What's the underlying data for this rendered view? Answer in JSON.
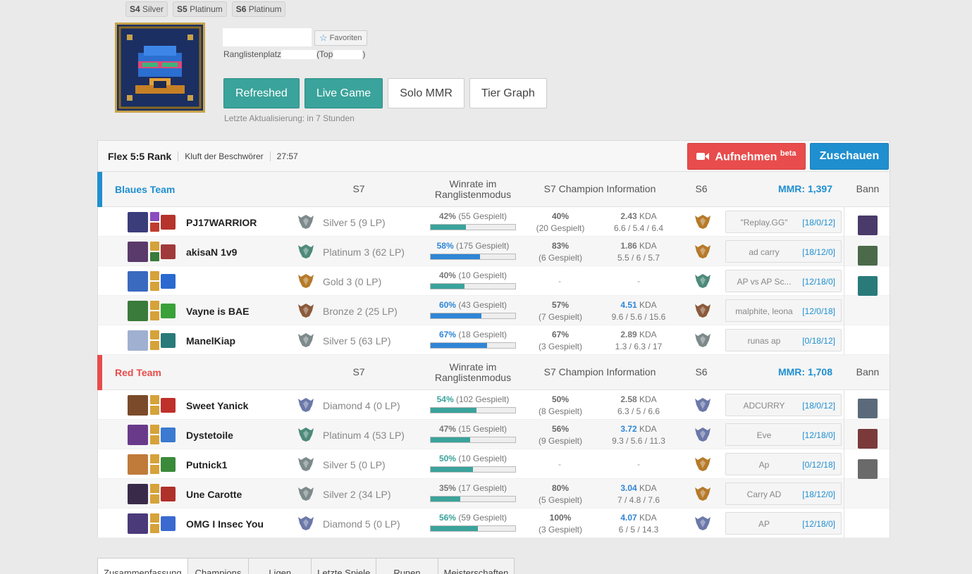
{
  "seasons": [
    {
      "season": "S4",
      "tier": "Silver"
    },
    {
      "season": "S5",
      "tier": "Platinum"
    },
    {
      "season": "S6",
      "tier": "Platinum"
    }
  ],
  "profile": {
    "favorite_label": "Favoriten",
    "ladder_label": "Ranglistenplatz",
    "top_label": "(Top",
    "top_close": ")"
  },
  "buttons": {
    "refreshed": "Refreshed",
    "live_game": "Live Game",
    "solo_mmr": "Solo MMR",
    "tier_graph": "Tier Graph"
  },
  "last_update": "Letzte Aktualisierung: in 7 Stunden",
  "game": {
    "mode": "Flex 5:5 Rank",
    "map": "Kluft der Beschwörer",
    "time": "27:57",
    "record_label": "Aufnehmen",
    "record_sup": "beta",
    "watch_label": "Zuschauen"
  },
  "headers": {
    "s7": "S7",
    "winrate_line1": "Winrate im",
    "winrate_line2": "Ranglistenmodus",
    "champ_info": "S7 Champion Information",
    "s6": "S6",
    "bann": "Bann"
  },
  "colors": {
    "blue_team": "#1f8fd0",
    "red_team": "#e84c4c",
    "teal": "#3aa39b",
    "bar_blue": "#2f86d6",
    "bar_teal": "#3aa39b"
  },
  "teams": [
    {
      "name": "Blaues Team",
      "mmr": "MMR: 1,397",
      "players": [
        {
          "name": "PJ17WARRIOR",
          "tier_icon": "silver-emblem-icon",
          "tier": "Silver 5 (9 LP)",
          "wr": "42%",
          "games": "(55 Gespielt)",
          "wr_value": 42,
          "c_wr": "40%",
          "c_games": "(20 Gespielt)",
          "kda": "2.43",
          "kda_detail": "6.6 / 5.4 / 6.4",
          "s6_icon": "gold-emblem-icon",
          "note": "\"Replay.GG\"",
          "score": "[18/0/12]"
        },
        {
          "name": "akisaN 1v9",
          "tier_icon": "platinum-emblem-icon",
          "tier": "Platinum 3 (62 LP)",
          "wr": "58%",
          "games": "(175 Gespielt)",
          "wr_value": 58,
          "c_wr": "83%",
          "c_games": "(6 Gespielt)",
          "kda": "1.86",
          "kda_detail": "5.5 / 6 / 5.7",
          "s6_icon": "gold-emblem-icon",
          "note": "ad carry",
          "score": "[18/12/0]"
        },
        {
          "name": "",
          "tier_icon": "gold-emblem-icon",
          "tier": "Gold 3 (0 LP)",
          "wr": "40%",
          "games": "(10 Gespielt)",
          "wr_value": 40,
          "c_wr": "-",
          "c_games": "",
          "kda": "-",
          "kda_detail": "",
          "s6_icon": "platinum-emblem-icon",
          "note": "AP vs AP Sc...",
          "score": "[12/18/0]"
        },
        {
          "name": "Vayne is BAE",
          "tier_icon": "bronze-emblem-icon",
          "tier": "Bronze 2 (25 LP)",
          "wr": "60%",
          "games": "(43 Gespielt)",
          "wr_value": 60,
          "c_wr": "57%",
          "c_games": "(7 Gespielt)",
          "kda": "4.51",
          "kda_detail": "9.6 / 5.6 / 15.6",
          "s6_icon": "bronze-emblem-icon",
          "note": "malphite, leona",
          "score": "[12/0/18]"
        },
        {
          "name": "ManelKiap",
          "tier_icon": "silver-emblem-icon",
          "tier": "Silver 5 (63 LP)",
          "wr": "67%",
          "games": "(18 Gespielt)",
          "wr_value": 67,
          "c_wr": "67%",
          "c_games": "(3 Gespielt)",
          "kda": "2.89",
          "kda_detail": "1.3 / 6.3 / 17",
          "s6_icon": "silver-emblem-icon",
          "note": "runas ap",
          "score": "[0/18/12]"
        }
      ]
    },
    {
      "name": "Red Team",
      "mmr": "MMR: 1,708",
      "players": [
        {
          "name": "Sweet Yanick",
          "tier_icon": "diamond-emblem-icon",
          "tier": "Diamond 4 (0 LP)",
          "wr": "54%",
          "games": "(102 Gespielt)",
          "wr_value": 54,
          "c_wr": "50%",
          "c_games": "(8 Gespielt)",
          "kda": "2.58",
          "kda_detail": "6.3 / 5 / 6.6",
          "s6_icon": "diamond-emblem-icon",
          "note": "ADCURRY",
          "score": "[18/0/12]"
        },
        {
          "name": "Dystetoile",
          "tier_icon": "platinum-emblem-icon",
          "tier": "Platinum 4 (53 LP)",
          "wr": "47%",
          "games": "(15 Gespielt)",
          "wr_value": 47,
          "c_wr": "56%",
          "c_games": "(9 Gespielt)",
          "kda": "3.72",
          "kda_detail": "9.3 / 5.6 / 11.3",
          "s6_icon": "diamond-emblem-icon",
          "note": "Eve",
          "score": "[12/18/0]"
        },
        {
          "name": "Putnick1",
          "tier_icon": "silver-emblem-icon",
          "tier": "Silver 5 (0 LP)",
          "wr": "50%",
          "games": "(10 Gespielt)",
          "wr_value": 50,
          "c_wr": "-",
          "c_games": "",
          "kda": "-",
          "kda_detail": "",
          "s6_icon": "gold-emblem-icon",
          "note": "Ap",
          "score": "[0/12/18]"
        },
        {
          "name": "Une Carotte",
          "tier_icon": "silver-emblem-icon",
          "tier": "Silver 2 (34 LP)",
          "wr": "35%",
          "games": "(17 Gespielt)",
          "wr_value": 35,
          "c_wr": "80%",
          "c_games": "(5 Gespielt)",
          "kda": "3.04",
          "kda_detail": "7 / 4.8 / 7.6",
          "s6_icon": "gold-emblem-icon",
          "note": "Carry AD",
          "score": "[18/12/0]"
        },
        {
          "name": "OMG I Insec You",
          "tier_icon": "diamond-emblem-icon",
          "tier": "Diamond 5 (0 LP)",
          "wr": "56%",
          "games": "(59 Gespielt)",
          "wr_value": 56,
          "c_wr": "100%",
          "c_games": "(3 Gespielt)",
          "kda": "4.07",
          "kda_detail": "6 / 5 / 14.3",
          "s6_icon": "diamond-emblem-icon",
          "note": "AP",
          "score": "[12/18/0]"
        }
      ]
    }
  ],
  "tabs": [
    "Zusammenfassung",
    "Champions",
    "Ligen",
    "Letzte Spiele",
    "Runen",
    "Meisterschaften"
  ]
}
